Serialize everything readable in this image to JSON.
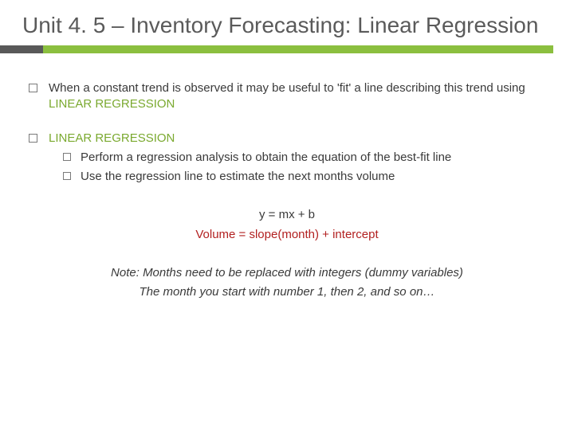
{
  "title": "Unit 4. 5 – Inventory Forecasting: Linear Regression",
  "bullets": {
    "b1_pre": "When a constant trend is observed it may be useful to 'fit' a line describing this trend using ",
    "b1_green": "LINEAR REGRESSION",
    "b2_green": "LINEAR REGRESSION",
    "sub1": "Perform a regression analysis to obtain the equation of the best-fit line",
    "sub2": "Use the regression line to estimate the next months volume"
  },
  "equations": {
    "eq1": "y = mx + b",
    "eq2": "Volume = slope(month) + intercept"
  },
  "note": {
    "line1": "Note: Months need to be replaced with integers (dummy variables)",
    "line2": "The month you start with number 1, then 2, and so on…"
  }
}
